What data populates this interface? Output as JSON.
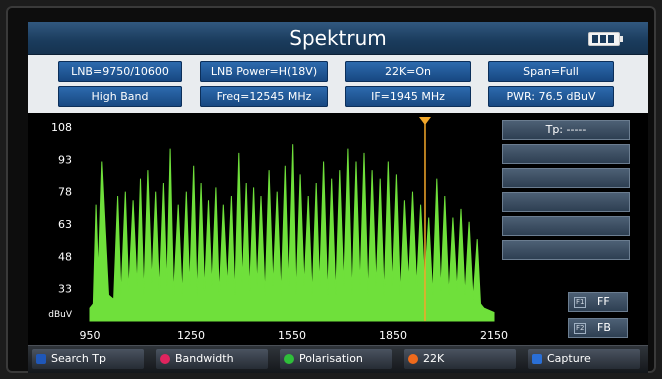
{
  "screen": {
    "title": "Spektrum"
  },
  "status": {
    "battery_icon": "battery-icon"
  },
  "info_chips": {
    "lnb": "LNB=9750/10600",
    "lnb_power": "LNB Power=H(18V)",
    "tone_22k": "22K=On",
    "span": "Span=Full",
    "band": "High Band",
    "freq": "Freq=12545 MHz",
    "if": "IF=1945 MHz",
    "pwr": "PWR: 76.5 dBuV"
  },
  "side_panel": {
    "tp_label": "Tp: -----"
  },
  "fkeys": [
    {
      "key": "F1",
      "label": "FF"
    },
    {
      "key": "F2",
      "label": "FB"
    }
  ],
  "softkeys": [
    {
      "label": "Search Tp",
      "color": "#1f57b8",
      "shape": "rect"
    },
    {
      "label": "Bandwidth",
      "color": "#e0245e",
      "shape": "dot"
    },
    {
      "label": "Polarisation",
      "color": "#2fbf3a",
      "shape": "dot"
    },
    {
      "label": "22K",
      "color": "#ef6a1c",
      "shape": "dot"
    },
    {
      "label": "Capture",
      "color": "#2a6fd6",
      "shape": "rect"
    }
  ],
  "colors": {
    "trace": "#6fe03b",
    "marker": "#f2a72a",
    "grid_text": "#ffffff"
  },
  "chart_data": {
    "type": "area",
    "title": "",
    "xlabel": "",
    "ylabel": "dBuV",
    "xlim": [
      950,
      2150
    ],
    "ylim": [
      18,
      108
    ],
    "x_ticks": [
      950,
      1250,
      1550,
      1850,
      2150
    ],
    "y_ticks": [
      108,
      93,
      78,
      63,
      48,
      33
    ],
    "marker_x": 1945,
    "grid": false,
    "series": [
      {
        "values": [
          [
            950,
            24
          ],
          [
            960,
            26
          ],
          [
            968,
            72
          ],
          [
            975,
            40
          ],
          [
            985,
            92
          ],
          [
            995,
            60
          ],
          [
            1005,
            30
          ],
          [
            1020,
            28
          ],
          [
            1032,
            76
          ],
          [
            1042,
            30
          ],
          [
            1055,
            78
          ],
          [
            1065,
            32
          ],
          [
            1078,
            74
          ],
          [
            1090,
            34
          ],
          [
            1100,
            84
          ],
          [
            1110,
            30
          ],
          [
            1122,
            88
          ],
          [
            1134,
            36
          ],
          [
            1145,
            78
          ],
          [
            1156,
            32
          ],
          [
            1168,
            82
          ],
          [
            1178,
            34
          ],
          [
            1188,
            98
          ],
          [
            1198,
            30
          ],
          [
            1212,
            72
          ],
          [
            1224,
            30
          ],
          [
            1236,
            78
          ],
          [
            1246,
            34
          ],
          [
            1258,
            90
          ],
          [
            1268,
            30
          ],
          [
            1280,
            82
          ],
          [
            1290,
            32
          ],
          [
            1302,
            74
          ],
          [
            1312,
            34
          ],
          [
            1324,
            80
          ],
          [
            1334,
            30
          ],
          [
            1346,
            72
          ],
          [
            1358,
            34
          ],
          [
            1370,
            76
          ],
          [
            1380,
            30
          ],
          [
            1392,
            96
          ],
          [
            1402,
            36
          ],
          [
            1414,
            82
          ],
          [
            1424,
            32
          ],
          [
            1436,
            80
          ],
          [
            1446,
            34
          ],
          [
            1458,
            76
          ],
          [
            1470,
            30
          ],
          [
            1482,
            88
          ],
          [
            1494,
            34
          ],
          [
            1506,
            78
          ],
          [
            1518,
            30
          ],
          [
            1530,
            90
          ],
          [
            1540,
            34
          ],
          [
            1552,
            100
          ],
          [
            1562,
            30
          ],
          [
            1574,
            86
          ],
          [
            1586,
            34
          ],
          [
            1598,
            76
          ],
          [
            1610,
            30
          ],
          [
            1622,
            82
          ],
          [
            1632,
            34
          ],
          [
            1644,
            92
          ],
          [
            1656,
            30
          ],
          [
            1668,
            84
          ],
          [
            1680,
            30
          ],
          [
            1692,
            88
          ],
          [
            1704,
            34
          ],
          [
            1716,
            98
          ],
          [
            1728,
            30
          ],
          [
            1740,
            92
          ],
          [
            1752,
            34
          ],
          [
            1764,
            96
          ],
          [
            1776,
            30
          ],
          [
            1788,
            88
          ],
          [
            1800,
            34
          ],
          [
            1812,
            84
          ],
          [
            1824,
            30
          ],
          [
            1836,
            92
          ],
          [
            1848,
            34
          ],
          [
            1860,
            86
          ],
          [
            1872,
            30
          ],
          [
            1884,
            74
          ],
          [
            1896,
            36
          ],
          [
            1908,
            78
          ],
          [
            1920,
            34
          ],
          [
            1932,
            72
          ],
          [
            1944,
            36
          ],
          [
            1956,
            66
          ],
          [
            1968,
            30
          ],
          [
            1980,
            84
          ],
          [
            1992,
            32
          ],
          [
            2004,
            76
          ],
          [
            2016,
            30
          ],
          [
            2028,
            66
          ],
          [
            2040,
            32
          ],
          [
            2052,
            70
          ],
          [
            2064,
            30
          ],
          [
            2076,
            64
          ],
          [
            2088,
            28
          ],
          [
            2100,
            56
          ],
          [
            2110,
            26
          ],
          [
            2120,
            24
          ],
          [
            2150,
            22
          ]
        ]
      }
    ]
  }
}
